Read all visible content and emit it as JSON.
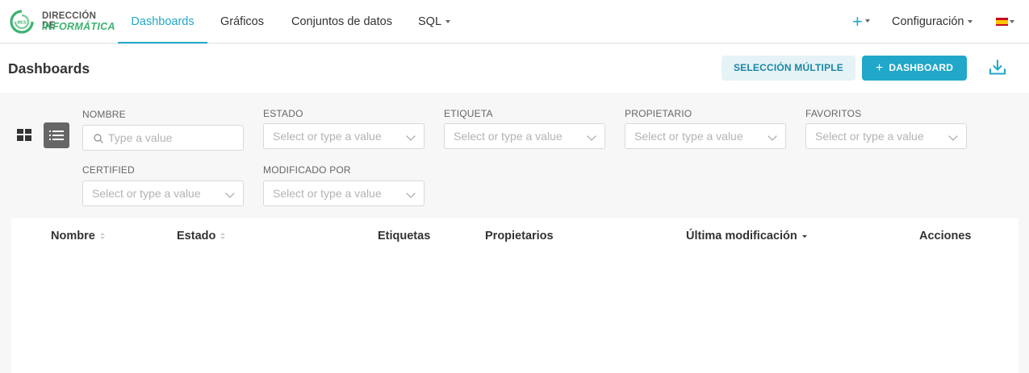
{
  "logo": {
    "line1": "DIRECCIÓN DE",
    "line2": "INFORMÁTICA",
    "badge": "MCS"
  },
  "nav": {
    "dashboards": "Dashboards",
    "charts": "Gráficos",
    "datasets": "Conjuntos de datos",
    "sql": "SQL",
    "plus": "+",
    "settings": "Configuración",
    "language_flag": "es-flag"
  },
  "header": {
    "title": "Dashboards",
    "bulk_select": "SELECCIÓN MÚLTIPLE",
    "add_dashboard": "DASHBOARD"
  },
  "filters": [
    {
      "label": "NOMBRE",
      "placeholder": "Type a value",
      "kind": "search"
    },
    {
      "label": "ESTADO",
      "placeholder": "Select or type a value",
      "kind": "select"
    },
    {
      "label": "ETIQUETA",
      "placeholder": "Select or type a value",
      "kind": "select"
    },
    {
      "label": "PROPIETARIO",
      "placeholder": "Select or type a value",
      "kind": "select"
    },
    {
      "label": "FAVORITOS",
      "placeholder": "Select or type a value",
      "kind": "select"
    },
    {
      "label": "CERTIFIED",
      "placeholder": "Select or type a value",
      "kind": "select"
    },
    {
      "label": "MODIFICADO POR",
      "placeholder": "Select or type a value",
      "kind": "select"
    }
  ],
  "table": {
    "columns": [
      {
        "label": "Nombre",
        "sortable": true
      },
      {
        "label": "Estado",
        "sortable": true
      },
      {
        "label": "Etiquetas",
        "sortable": false
      },
      {
        "label": "Propietarios",
        "sortable": false
      },
      {
        "label": "Última modificación",
        "sortable": true,
        "sorted": "desc"
      },
      {
        "label": "Acciones",
        "sortable": false
      }
    ],
    "rows": []
  },
  "colors": {
    "accent": "#20a7c9",
    "logo_green": "#3cb371"
  },
  "icons": {
    "add": "plus-icon",
    "download": "download-icon",
    "card_view": "grid-view-icon",
    "list_view": "list-view-icon",
    "search": "search-icon"
  }
}
